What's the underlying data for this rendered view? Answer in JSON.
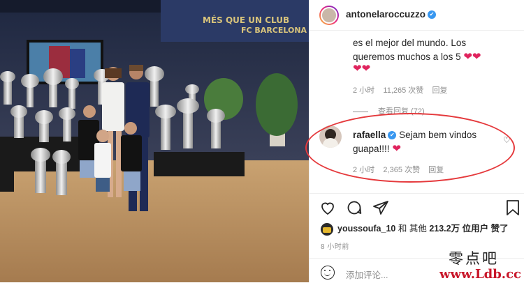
{
  "photo": {
    "banner_slogan": "MÉS QUE UN CLUB",
    "banner_brand": "FC BARCELONA"
  },
  "post": {
    "username": "antonelaroccuzzo",
    "verified": "✔",
    "caption_line1": "es el mejor del mundo. Los",
    "caption_line2": "queremos muchos a los 5",
    "time": "2 小时",
    "likes": "11,265 次赞",
    "reply": "回复",
    "view_replies": "查看回复 (72)"
  },
  "comment": {
    "username": "rafaella",
    "text_line1": "Sejam bem vindos",
    "text_line2": "guapa!!!!",
    "time": "2 小时",
    "likes": "2,365 次赞",
    "reply": "回复"
  },
  "liked_by": {
    "user": "youssoufa_10",
    "and_others": "和 其他",
    "count": "213.2万",
    "suffix": "位用户 赞了"
  },
  "post_time": "8 小时前",
  "add_comment_placeholder": "添加评论...",
  "watermark": {
    "line1": "零点吧",
    "line2": "www.Ldb.cc"
  },
  "colors": {
    "heart": "#e0245e",
    "verified": "#3897f0",
    "highlight_oval": "#e5393c"
  },
  "icons": [
    "heart-icon",
    "comment-icon",
    "share-icon",
    "bookmark-icon",
    "emoji-icon",
    "verified-badge-icon"
  ]
}
